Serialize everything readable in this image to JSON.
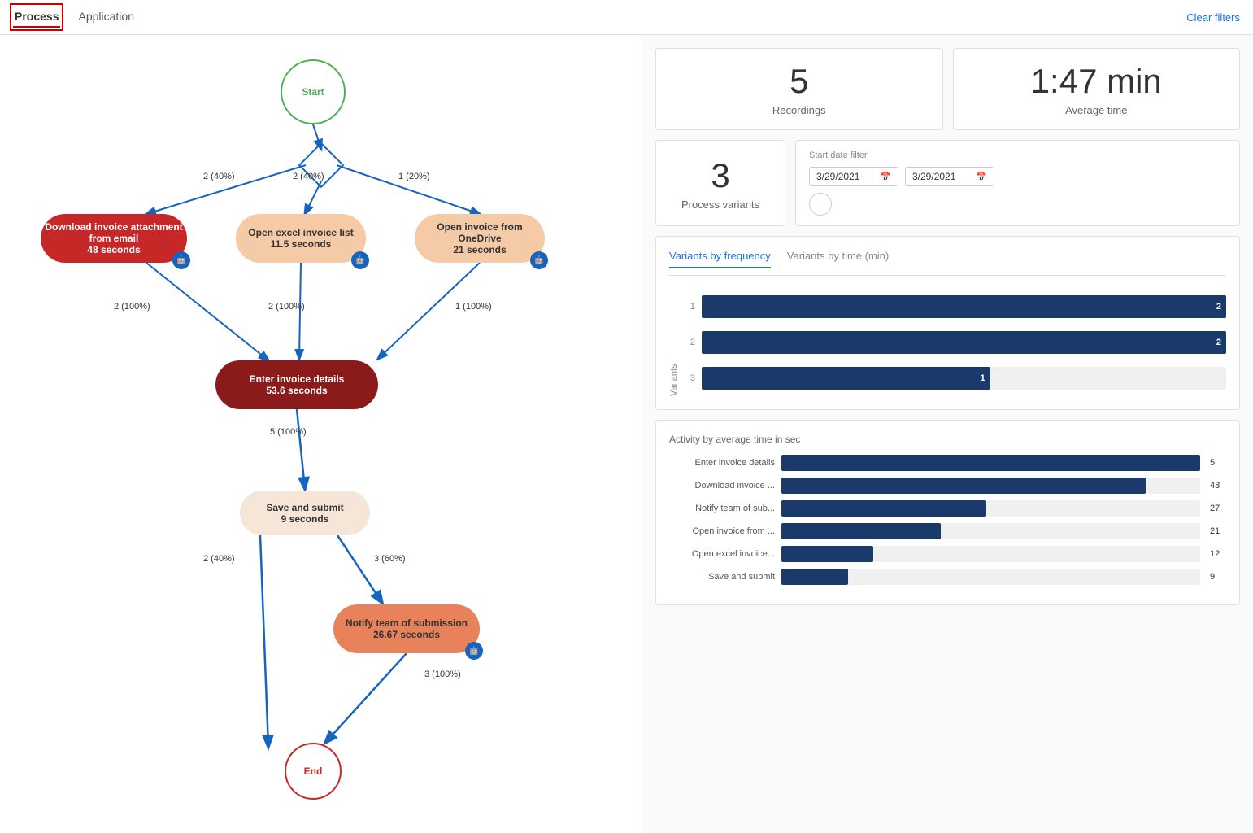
{
  "nav": {
    "tabs": [
      {
        "label": "Process",
        "active": true
      },
      {
        "label": "Application",
        "active": false
      }
    ],
    "clear_filters": "Clear filters"
  },
  "stats": {
    "recordings": {
      "value": "5",
      "label": "Recordings"
    },
    "avg_time": {
      "value": "1:47 min",
      "label": "Average time"
    },
    "process_variants": {
      "value": "3",
      "label": "Process variants"
    }
  },
  "date_filter": {
    "label": "Start date filter",
    "from": "3/29/2021",
    "to": "3/29/2021"
  },
  "variants_chart": {
    "tab1": "Variants by frequency",
    "tab2": "Variants by time (min)",
    "y_axis": "Variants",
    "bars": [
      {
        "label": "1",
        "value": 2,
        "pct": 100
      },
      {
        "label": "2",
        "value": 2,
        "pct": 100
      },
      {
        "label": "3",
        "value": 1,
        "pct": 55
      }
    ]
  },
  "activity_chart": {
    "title": "Activity by average time in sec",
    "max": 55,
    "bars": [
      {
        "label": "Enter invoice details",
        "value": 55,
        "display": "5"
      },
      {
        "label": "Download invoice ...",
        "value": 48,
        "display": "48"
      },
      {
        "label": "Notify team of sub...",
        "value": 27,
        "display": "27"
      },
      {
        "label": "Open invoice from ...",
        "value": 21,
        "display": "21"
      },
      {
        "label": "Open excel invoice...",
        "value": 12,
        "display": "12"
      },
      {
        "label": "Save and submit",
        "value": 9,
        "display": "9"
      }
    ]
  },
  "flow": {
    "nodes": {
      "start": "Start",
      "end": "End",
      "download": "Download invoice attachment from email\n48 seconds",
      "excel": "Open excel invoice list\n11.5 seconds",
      "onedrive": "Open invoice from OneDrive\n21 seconds",
      "enter": "Enter invoice details\n53.6 seconds",
      "save": "Save and submit\n9 seconds",
      "notify": "Notify team of submission\n26.67 seconds"
    },
    "edges": {
      "start_download": "2\n(40%)",
      "start_excel": "2\n(40%)",
      "start_onedrive": "1\n(20%)",
      "download_enter": "2\n(100%)",
      "excel_enter": "2\n(100%)",
      "onedrive_enter": "1\n(100%)",
      "enter_save": "5\n(100%)",
      "save_notify": "3\n(60%)",
      "save_end": "2\n(40%)",
      "notify_end": "3\n(100%)"
    }
  }
}
